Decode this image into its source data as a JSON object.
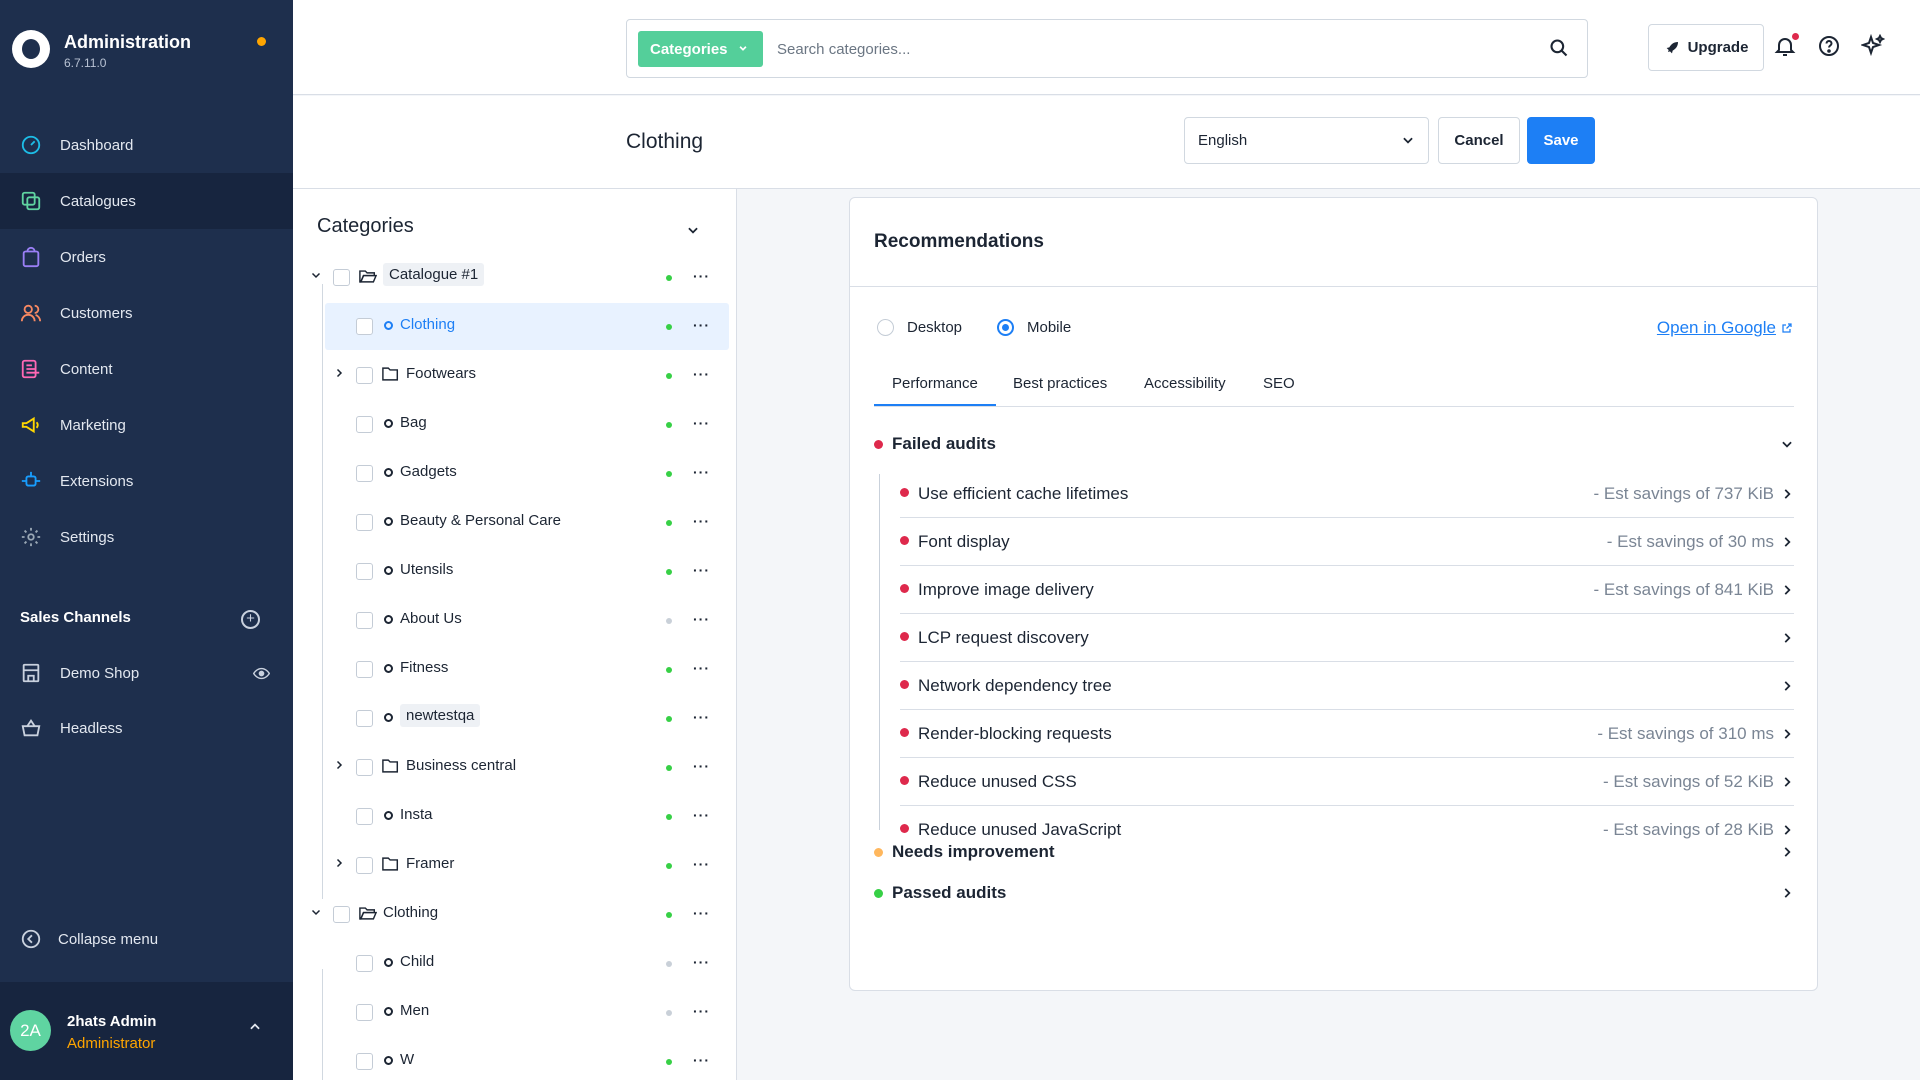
{
  "app": {
    "title": "Administration",
    "version": "6.7.11.0"
  },
  "nav": {
    "items": [
      {
        "label": "Dashboard",
        "icon": "dashboard-icon",
        "color": "#1dbde6"
      },
      {
        "label": "Catalogues",
        "icon": "catalogue-icon",
        "color": "#5fd4a1"
      },
      {
        "label": "Orders",
        "icon": "orders-icon",
        "color": "#9a7ff5"
      },
      {
        "label": "Customers",
        "icon": "customers-icon",
        "color": "#f88962"
      },
      {
        "label": "Content",
        "icon": "content-icon",
        "color": "#ff68b4"
      },
      {
        "label": "Marketing",
        "icon": "marketing-icon",
        "color": "#ffd700"
      },
      {
        "label": "Extensions",
        "icon": "extensions-icon",
        "color": "#189eff"
      },
      {
        "label": "Settings",
        "icon": "settings-icon",
        "color": "#9aa8b5"
      }
    ],
    "active_index": 1
  },
  "sales_channels": {
    "title": "Sales Channels",
    "items": [
      {
        "label": "Demo Shop",
        "icon": "storefront-icon"
      },
      {
        "label": "Headless",
        "icon": "basket-icon"
      }
    ]
  },
  "collapse_label": "Collapse menu",
  "user": {
    "initials": "2A",
    "name": "2hats Admin",
    "role": "Administrator"
  },
  "search": {
    "type_label": "Categories",
    "placeholder": "Search categories..."
  },
  "topbar": {
    "upgrade_label": "Upgrade"
  },
  "smartbar": {
    "title": "Clothing",
    "language": "English",
    "cancel_label": "Cancel",
    "save_label": "Save"
  },
  "tree": {
    "header": "Categories",
    "rows": [
      {
        "label": "Catalogue #1",
        "level": 0,
        "kind": "folder-open",
        "expanded": true,
        "active": true,
        "pill": true
      },
      {
        "label": "Clothing",
        "level": 1,
        "kind": "leaf",
        "active": true,
        "selected": true
      },
      {
        "label": "Footwears",
        "level": 1,
        "kind": "folder",
        "collapsed": true,
        "active": true
      },
      {
        "label": "Bag",
        "level": 1,
        "kind": "leaf",
        "active": true
      },
      {
        "label": "Gadgets",
        "level": 1,
        "kind": "leaf",
        "active": true
      },
      {
        "label": "Beauty & Personal Care",
        "level": 1,
        "kind": "leaf",
        "active": true
      },
      {
        "label": "Utensils",
        "level": 1,
        "kind": "leaf",
        "active": true
      },
      {
        "label": "About Us",
        "level": 1,
        "kind": "leaf",
        "active": false
      },
      {
        "label": "Fitness",
        "level": 1,
        "kind": "leaf",
        "active": true
      },
      {
        "label": "newtestqa",
        "level": 1,
        "kind": "leaf",
        "active": true,
        "pill": true
      },
      {
        "label": "Business central",
        "level": 1,
        "kind": "folder",
        "collapsed": true,
        "active": true
      },
      {
        "label": "Insta",
        "level": 1,
        "kind": "leaf",
        "active": true
      },
      {
        "label": "Framer",
        "level": 1,
        "kind": "folder",
        "collapsed": true,
        "active": true
      },
      {
        "label": "Clothing",
        "level": 0,
        "kind": "folder-open",
        "expanded": true,
        "active": true
      },
      {
        "label": "Child",
        "level": 1,
        "kind": "leaf",
        "active": false
      },
      {
        "label": "Men",
        "level": 1,
        "kind": "leaf",
        "active": false
      },
      {
        "label": "W",
        "level": 1,
        "kind": "leaf",
        "active": true
      }
    ]
  },
  "recommendations": {
    "title": "Recommendations",
    "device_options": [
      "Desktop",
      "Mobile"
    ],
    "selected_device": "Mobile",
    "open_link": "Open in Google",
    "tabs": [
      "Performance",
      "Best practices",
      "Accessibility",
      "SEO"
    ],
    "active_tab": "Performance",
    "failed": {
      "label": "Failed audits",
      "color": "#de294c",
      "items": [
        {
          "label": "Use efficient cache lifetimes",
          "savings": "- Est savings of 737 KiB"
        },
        {
          "label": "Font display",
          "savings": "- Est savings of 30 ms"
        },
        {
          "label": "Improve image delivery",
          "savings": "- Est savings of 841 KiB"
        },
        {
          "label": "LCP request discovery",
          "savings": ""
        },
        {
          "label": "Network dependency tree",
          "savings": ""
        },
        {
          "label": "Render-blocking requests",
          "savings": "- Est savings of 310 ms"
        },
        {
          "label": "Reduce unused CSS",
          "savings": "- Est savings of 52 KiB"
        },
        {
          "label": "Reduce unused JavaScript",
          "savings": "- Est savings of 28 KiB"
        }
      ]
    },
    "needs_improvement": {
      "label": "Needs improvement",
      "color": "#ffb75d"
    },
    "passed": {
      "label": "Passed audits",
      "color": "#37d046"
    }
  }
}
